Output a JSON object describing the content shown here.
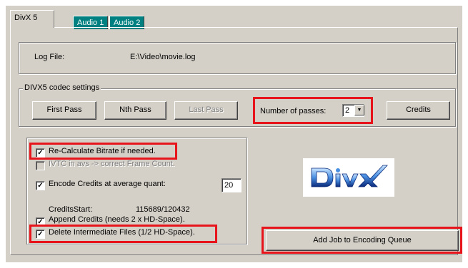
{
  "tabs": [
    {
      "label": "DivX 5"
    },
    {
      "label": "Audio 1"
    },
    {
      "label": "Audio 2"
    }
  ],
  "log": {
    "label": "Log File:",
    "value": "E:\\Video\\movie.log"
  },
  "codec": {
    "legend": "DIVX5 codec settings",
    "first_pass": "First Pass",
    "nth_pass": "Nth Pass",
    "last_pass": "Last Pass",
    "passes_label": "Number of passes:",
    "passes_value": "2",
    "credits": "Credits"
  },
  "options": {
    "recalc": {
      "label": "Re-Calculate Bitrate if needed.",
      "checked": true
    },
    "ivtc": {
      "label": "IVTC in avs -> correct Frame Count.",
      "checked": false
    },
    "encode_credits": {
      "label": "Encode Credits at average quant:",
      "checked": true,
      "value": "20"
    },
    "credits_start_label": "CreditsStart:",
    "credits_start_value": "115689/120432",
    "append": {
      "label": "Append Credits (needs 2 x HD-Space).",
      "checked": true
    },
    "delete": {
      "label": "Delete Intermediate Files (1/2 HD-Space).",
      "checked": true
    }
  },
  "queue_button": "Add Job to Encoding Queue",
  "logo": {
    "text": "DivX",
    "color": "#1a3a8a"
  },
  "colors": {
    "highlight": "#e8141b",
    "tab_inactive": "#008080",
    "panel": "#d4d0c8"
  }
}
